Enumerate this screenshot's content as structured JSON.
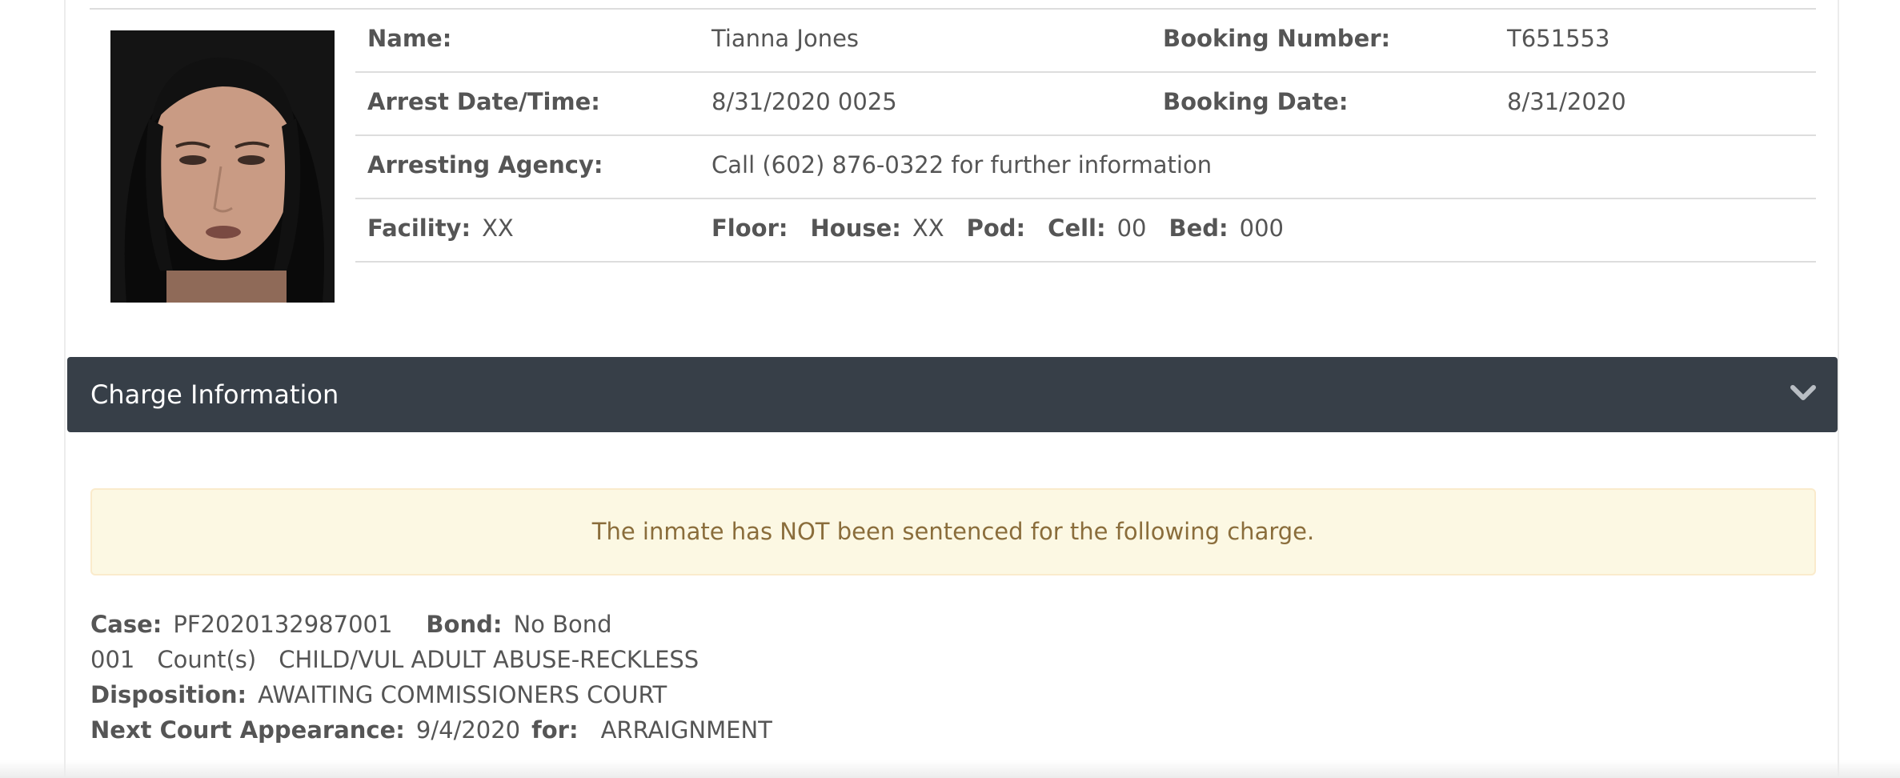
{
  "inmate": {
    "name_label": "Name:",
    "name": "Tianna Jones",
    "booking_number_label": "Booking Number:",
    "booking_number": "T651553",
    "arrest_label": "Arrest Date/Time:",
    "arrest_datetime": "8/31/2020 0025",
    "booking_date_label": "Booking Date:",
    "booking_date": "8/31/2020",
    "agency_label": "Arresting Agency:",
    "agency": "Call (602) 876-0322 for further information",
    "facility_label": "Facility:",
    "facility": "XX",
    "floor_label": "Floor:",
    "floor": "",
    "house_label": "House:",
    "house": "XX",
    "pod_label": "Pod:",
    "pod": "",
    "cell_label": "Cell:",
    "cell": "00",
    "bed_label": "Bed:",
    "bed": "000"
  },
  "charge_panel": {
    "title": "Charge Information",
    "toggle_icon": "chevron-down-icon",
    "alert": "The inmate has NOT been sentenced for the following charge.",
    "case_label": "Case:",
    "case_number": "PF2020132987001",
    "bond_label": "Bond:",
    "bond": "No Bond",
    "count_number": "001",
    "count_label": "Count(s)",
    "charge": "CHILD/VUL ADULT ABUSE-RECKLESS",
    "disposition_label": "Disposition:",
    "disposition": "AWAITING COMMISSIONERS COURT",
    "next_court_label": "Next Court Appearance:",
    "next_court_date": "9/4/2020",
    "for_label": "for:",
    "next_court_reason": "ARRAIGNMENT"
  },
  "colors": {
    "header_bg": "#373f48",
    "alert_bg": "#fcf8e3",
    "alert_text": "#8a6d3b",
    "text": "#555555"
  }
}
